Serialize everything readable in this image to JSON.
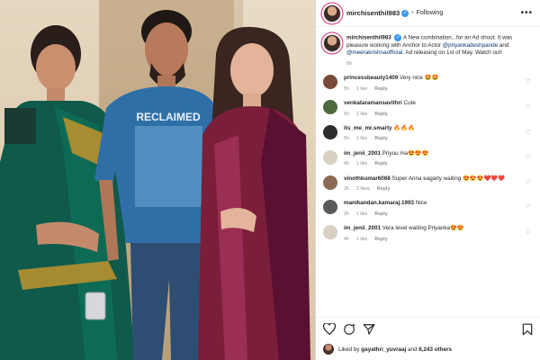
{
  "post": {
    "username": "mirchisenthil983",
    "follow_status": "Following",
    "caption": {
      "username": "mirchisenthil983",
      "text": "A New combination...for an Ad shoot. It was pleasure working with Anchor to Actor",
      "mention1": "@priyankadeshpande",
      "connector": "and",
      "mention2": "@meerakrishnaofficial",
      "text_end": ". Ad releasing on 1st of May. Watch out!",
      "time": "6h"
    },
    "photo_shirt_text": "RECLAIMED"
  },
  "comments": [
    {
      "username": "princessbeauty1409",
      "text": "Very nice 🤩🤩",
      "time": "5h",
      "likes": "1 like",
      "reply": "Reply",
      "avatar_color": "#7a4b3a"
    },
    {
      "username": "venkataramansavithri",
      "text": "Cute",
      "time": "5h",
      "likes": "1 like",
      "reply": "Reply",
      "avatar_color": "#4c6b3c"
    },
    {
      "username": "its_me_mr.smarty",
      "text": "🔥🔥🔥",
      "time": "5h",
      "likes": "1 like",
      "reply": "Reply",
      "avatar_color": "#2e2e2e"
    },
    {
      "username": "im_jenii_2001",
      "text": "Priyuu ma😍😍😍",
      "time": "4h",
      "likes": "1 like",
      "reply": "Reply",
      "avatar_color": "#d8d0c0"
    },
    {
      "username": "vinothkumar6068",
      "text": "Super Anna eagarly waiting 😍😍😍❤️❤️❤️",
      "time": "2h",
      "likes": "2 likes",
      "reply": "Reply",
      "avatar_color": "#8a6a52"
    },
    {
      "username": "manikandan.kamaraj.1993",
      "text": "Nice",
      "time": "3h",
      "likes": "1 like",
      "reply": "Reply",
      "avatar_color": "#5a5a5a"
    },
    {
      "username": "im_jenii_2001",
      "text": "Vera level waiting Priyanka😍😍",
      "time": "4h",
      "likes": "1 like",
      "reply": "Reply",
      "avatar_color": "#d8d0c0"
    }
  ],
  "footer": {
    "liked_by_prefix": "Liked by",
    "liked_by_user": "gayathri_yuvraaj",
    "liked_by_and": "and",
    "liked_by_count": "6,243 others"
  }
}
